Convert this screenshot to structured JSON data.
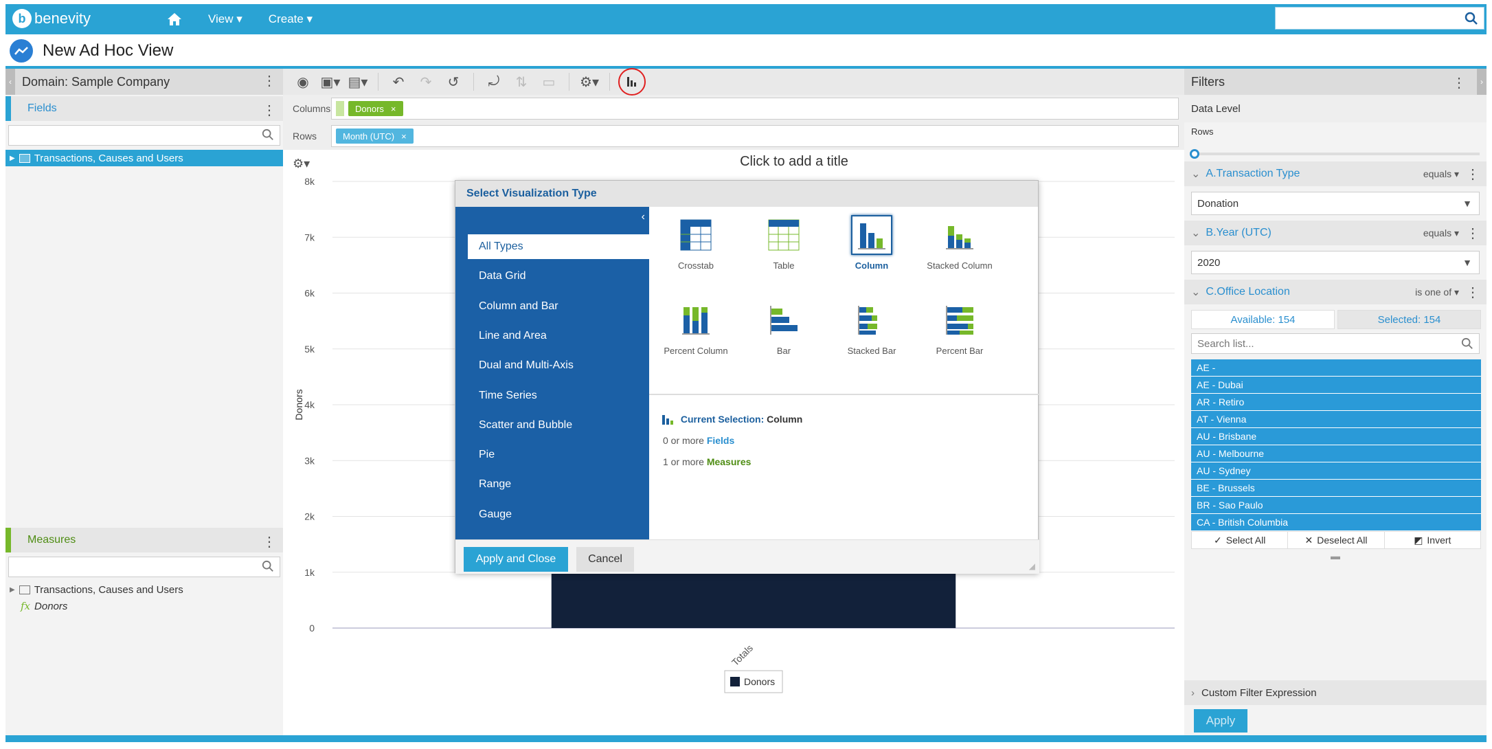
{
  "app": {
    "brand": "benevity",
    "logo_letter": "b",
    "nav": {
      "view": "View ▾",
      "create": "Create ▾"
    }
  },
  "page": {
    "title": "New Ad Hoc View"
  },
  "left": {
    "domain": "Domain: Sample Company",
    "fields_header": "Fields",
    "fields_tree": "Transactions, Causes and Users",
    "measures_header": "Measures",
    "measures_tree": "Transactions, Causes and Users",
    "measure_fx": "fx",
    "measure_item": "Donors"
  },
  "shelves": {
    "columns_label": "Columns",
    "rows_label": "Rows",
    "columns_pill": "Donors",
    "rows_pill": "Month (UTC)",
    "remove": "×"
  },
  "chart": {
    "title_placeholder": "Click to add a title"
  },
  "chart_data": {
    "type": "bar",
    "title": "",
    "categories": [
      "Totals"
    ],
    "series": [
      {
        "name": "Donors",
        "values": [
          7600
        ]
      }
    ],
    "xlabel": "",
    "ylabel": "Donors",
    "ylim": [
      0,
      8000
    ],
    "yticks": [
      "0",
      "1k",
      "2k",
      "3k",
      "4k",
      "5k",
      "6k",
      "7k",
      "8k"
    ],
    "color": "#12213a",
    "grid": true,
    "legend": "bottom-center"
  },
  "filters": {
    "header": "Filters",
    "data_level": "Data Level",
    "rows": "Rows",
    "f1": {
      "name": "A.Transaction Type",
      "op": "equals ▾",
      "value": "Donation"
    },
    "f2": {
      "name": "B.Year (UTC)",
      "op": "equals ▾",
      "value": "2020"
    },
    "f3": {
      "name": "C.Office Location",
      "op": "is one of ▾",
      "available": "Available: 154",
      "selected": "Selected: 154",
      "search_placeholder": "Search list...",
      "items": [
        "AE -",
        "AE - Dubai",
        "AR - Retiro",
        "AT - Vienna",
        "AU - Brisbane",
        "AU - Melbourne",
        "AU - Sydney",
        "BE - Brussels",
        "BR - Sao Paulo",
        "CA - British Columbia"
      ],
      "select_all": "Select All",
      "deselect_all": "Deselect All",
      "invert": "Invert"
    },
    "custom": "Custom Filter Expression",
    "apply": "Apply"
  },
  "modal": {
    "title": "Select Visualization Type",
    "types": [
      "All Types",
      "Data Grid",
      "Column and Bar",
      "Line and Area",
      "Dual and Multi-Axis",
      "Time Series",
      "Scatter and Bubble",
      "Pie",
      "Range",
      "Gauge"
    ],
    "viz": [
      "Crosstab",
      "Table",
      "Column",
      "Stacked Column",
      "Percent Column",
      "Bar",
      "Stacked Bar",
      "Percent Bar"
    ],
    "current_label": "Current Selection:",
    "current_value": "Column",
    "req1_pre": "0 or more",
    "req1_key": "Fields",
    "req2_pre": "1 or more",
    "req2_key": "Measures",
    "apply": "Apply and Close",
    "cancel": "Cancel"
  },
  "colors": {
    "accent": "#2aa3d4",
    "modal_nav": "#1b60a6",
    "bar": "#12213a",
    "field_green": "#76b82a"
  }
}
